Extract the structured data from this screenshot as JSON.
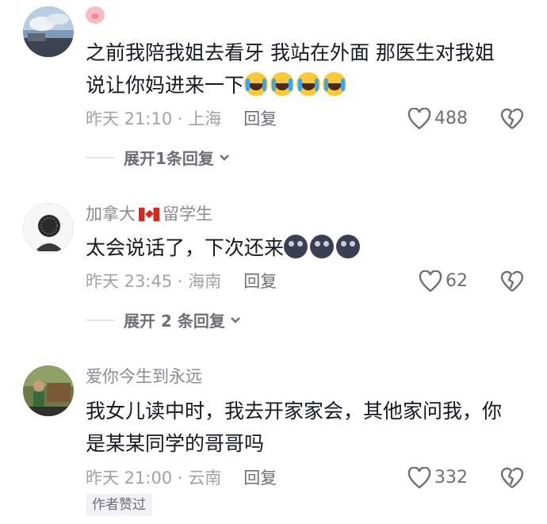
{
  "comments": [
    {
      "name": "",
      "text_line1": "之前我陪我姐去看牙 我站在外面  那医生对我姐",
      "text_line2": "说让你妈进来一下",
      "time": "昨天 21:10",
      "location": "上海",
      "reply_label": "回复",
      "likes": "488",
      "expand_label": "展开1条回复",
      "emoji": [
        "pig",
        "loudly-crying",
        "loudly-crying",
        "loudly-crying",
        "loudly-crying"
      ]
    },
    {
      "name_prefix": "加拿大",
      "name_suffix": "留学生",
      "text_line1": "太会说话了，下次还来",
      "time": "昨天 23:45",
      "location": "海南",
      "reply_label": "回复",
      "likes": "62",
      "expand_label": "展开 2 条回复",
      "emoji": [
        "canada-flag",
        "new-moon-face",
        "new-moon-face",
        "new-moon-face"
      ]
    },
    {
      "name": "爱你今生到永远",
      "text_line1": "我女儿读中时，我去开家家会，其他家问我，你",
      "text_line2": "是某某同学的哥哥吗",
      "time": "昨天 21:00",
      "location": "云南",
      "reply_label": "回复",
      "likes": "332",
      "badge": "作者赞过"
    }
  ],
  "colors": {
    "text": "#161823",
    "meta": "#a1a2a7",
    "secondary": "#6e6f74"
  }
}
